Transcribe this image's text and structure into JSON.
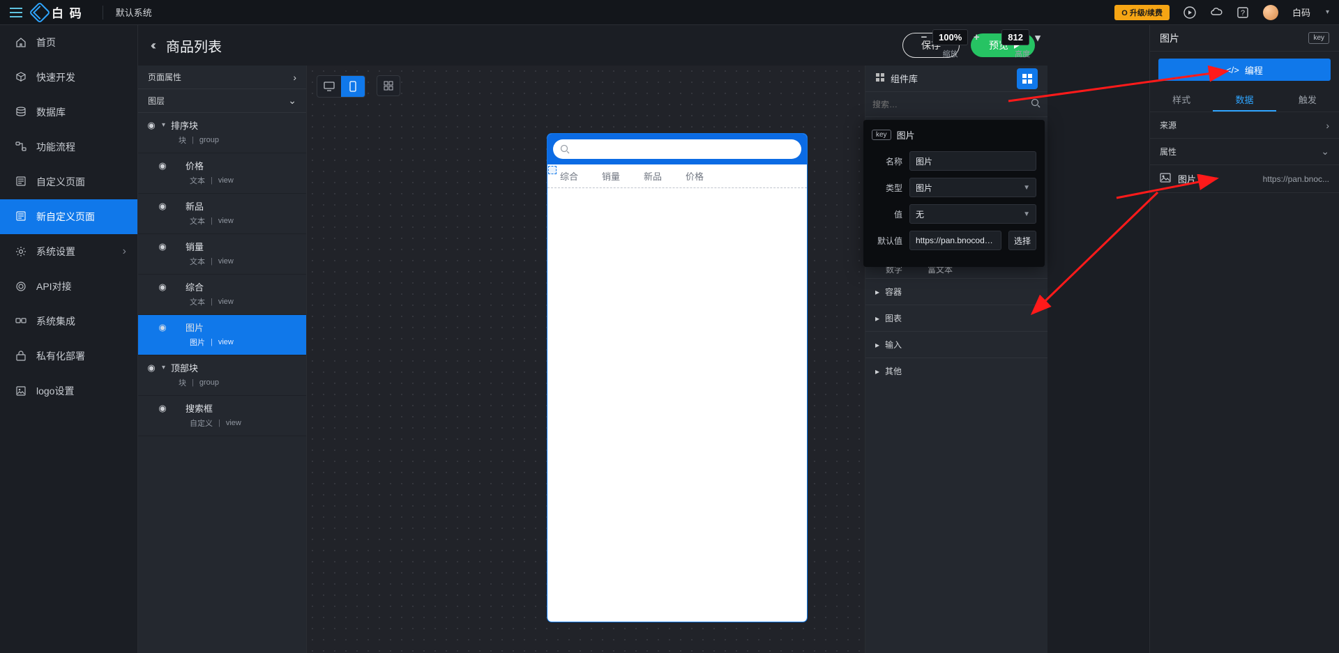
{
  "top": {
    "brand": "白 码",
    "system": "默认系统",
    "upgrade": "O 升级/续费",
    "user": "白码"
  },
  "sidebar": {
    "items": [
      {
        "label": "首页",
        "icon": "home-icon"
      },
      {
        "label": "快速开发",
        "icon": "cube-icon"
      },
      {
        "label": "数据库",
        "icon": "database-icon"
      },
      {
        "label": "功能流程",
        "icon": "flow-icon"
      },
      {
        "label": "自定义页面",
        "icon": "page-icon"
      },
      {
        "label": "新自定义页面",
        "icon": "newpage-icon"
      },
      {
        "label": "系统设置",
        "icon": "settings-icon",
        "chevron": true
      },
      {
        "label": "API对接",
        "icon": "api-icon"
      },
      {
        "label": "系统集成",
        "icon": "integrate-icon"
      },
      {
        "label": "私有化部署",
        "icon": "deploy-icon"
      },
      {
        "label": "logo设置",
        "icon": "logo-icon"
      }
    ],
    "activeIndex": 5
  },
  "header": {
    "title": "商品列表",
    "save": "保存",
    "preview": "预览",
    "zoom": {
      "minus": "−",
      "value": "100%",
      "plus": "+",
      "label": "缩放"
    },
    "height": {
      "value": "812",
      "label": "高度"
    }
  },
  "layerPanel": {
    "section1": "页面属性",
    "section2": "图层",
    "nodes": [
      {
        "title": "排序块",
        "sub1": "块",
        "sub2": "group",
        "caret": "▾"
      },
      {
        "title": "价格",
        "sub1": "文本",
        "sub2": "view",
        "indent": true
      },
      {
        "title": "新品",
        "sub1": "文本",
        "sub2": "view",
        "indent": true
      },
      {
        "title": "销量",
        "sub1": "文本",
        "sub2": "view",
        "indent": true
      },
      {
        "title": "综合",
        "sub1": "文本",
        "sub2": "view",
        "indent": true
      },
      {
        "title": "图片",
        "sub1": "图片",
        "sub2": "view",
        "indent": true,
        "active": true
      },
      {
        "title": "顶部块",
        "sub1": "块",
        "sub2": "group",
        "caret": "▾"
      },
      {
        "title": "搜索框",
        "sub1": "自定义",
        "sub2": "view",
        "indent": true
      }
    ]
  },
  "canvas": {
    "tabs": [
      "综合",
      "销量",
      "新品",
      "价格"
    ]
  },
  "complib": {
    "title": "组件库",
    "search_ph": "搜索…",
    "cards": [
      "数字",
      "富文本"
    ],
    "sections": [
      "容器",
      "图表",
      "输入",
      "其他"
    ]
  },
  "popover": {
    "key": "key",
    "title": "图片",
    "name_label": "名称",
    "name_value": "图片",
    "type_label": "类型",
    "type_value": "图片",
    "value_label": "值",
    "value_value": "无",
    "default_label": "默认值",
    "default_value": "https://pan.bnocode.co",
    "select": "选择"
  },
  "inspector": {
    "title": "图片",
    "key": "key",
    "code": "编程",
    "tabs": [
      "样式",
      "数据",
      "触发"
    ],
    "activeTab": 1,
    "sec_source": "来源",
    "sec_attr": "属性",
    "row_label": "图片",
    "row_value": "https://pan.bnoc..."
  }
}
